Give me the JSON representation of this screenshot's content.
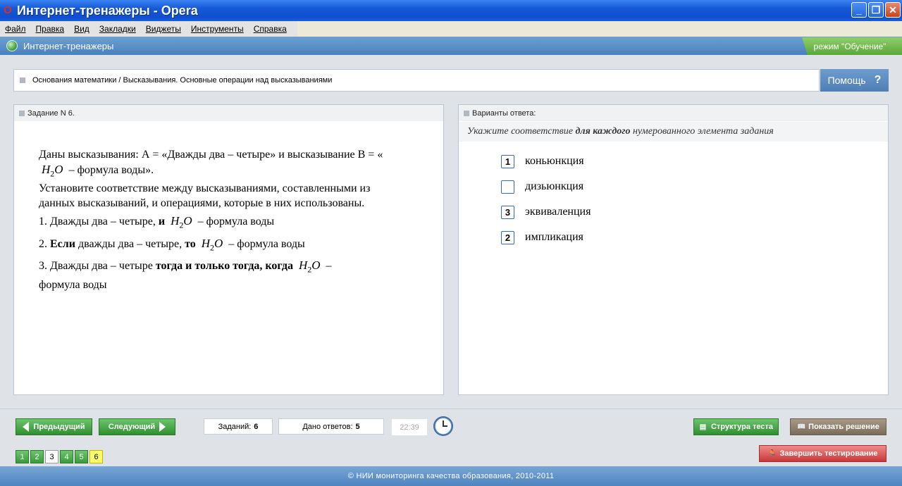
{
  "window": {
    "title": "Интернет-тренажеры - Opera",
    "minimize": "_",
    "restore": "❐",
    "close": "✕",
    "logo_glyph": "O"
  },
  "menu": [
    "Файл",
    "Правка",
    "Вид",
    "Закладки",
    "Виджеты",
    "Инструменты",
    "Справка"
  ],
  "app": {
    "title": "Интернет-тренажеры",
    "mode": "режим \"Обучение\""
  },
  "breadcrumb": "Основания математики / Высказывания. Основные операции над высказываниями",
  "help": {
    "label": "Помощь",
    "icon": "?"
  },
  "task": {
    "header": "Задание N 6.",
    "line1": "Даны высказывания: А = «Дважды два – четыре» и высказывание В = «",
    "line1_end": "– формула воды».",
    "line2": "Установите соответствие между высказываниями, составленными из данных высказываний, и операциями, которые в них использованы.",
    "item1_a": "1. Дважды два – четыре,",
    "item1_b": "и",
    "item1_c": "– формула воды",
    "item2_a": "2.",
    "item2_b": "Если",
    "item2_c": "дважды два – четыре,",
    "item2_d": "то",
    "item2_e": "– формула воды",
    "item3_a": "3. Дважды два – четыре",
    "item3_b": "тогда и только тогда, когда",
    "item3_c": "–",
    "item3_d": "формула воды",
    "formula_h": "H",
    "formula_sub": "2",
    "formula_o": "O"
  },
  "answers": {
    "header": "Варианты ответа:",
    "hint_a": "Укажите соответствие",
    "hint_b": "для каждого",
    "hint_c": "нумерованного элемента задания",
    "items": [
      {
        "value": "1",
        "label": "коньюнкция"
      },
      {
        "value": "",
        "label": "дизьюнкция"
      },
      {
        "value": "3",
        "label": "эквиваленция"
      },
      {
        "value": "2",
        "label": "импликация"
      }
    ]
  },
  "toolbar": {
    "prev": "Предыдущий",
    "next": "Следующий",
    "tasks_label": "Заданий:",
    "tasks_value": "6",
    "answered_label": "Дано ответов:",
    "answered_value": "5",
    "timer": "22:39",
    "structure": "Структура теста",
    "show_solution": "Показать решение",
    "finish": "Завершить тестирование",
    "pages": [
      "1",
      "2",
      "3",
      "4",
      "5",
      "6"
    ]
  },
  "footer": "© НИИ мониторинга качества образования, 2010-2011"
}
